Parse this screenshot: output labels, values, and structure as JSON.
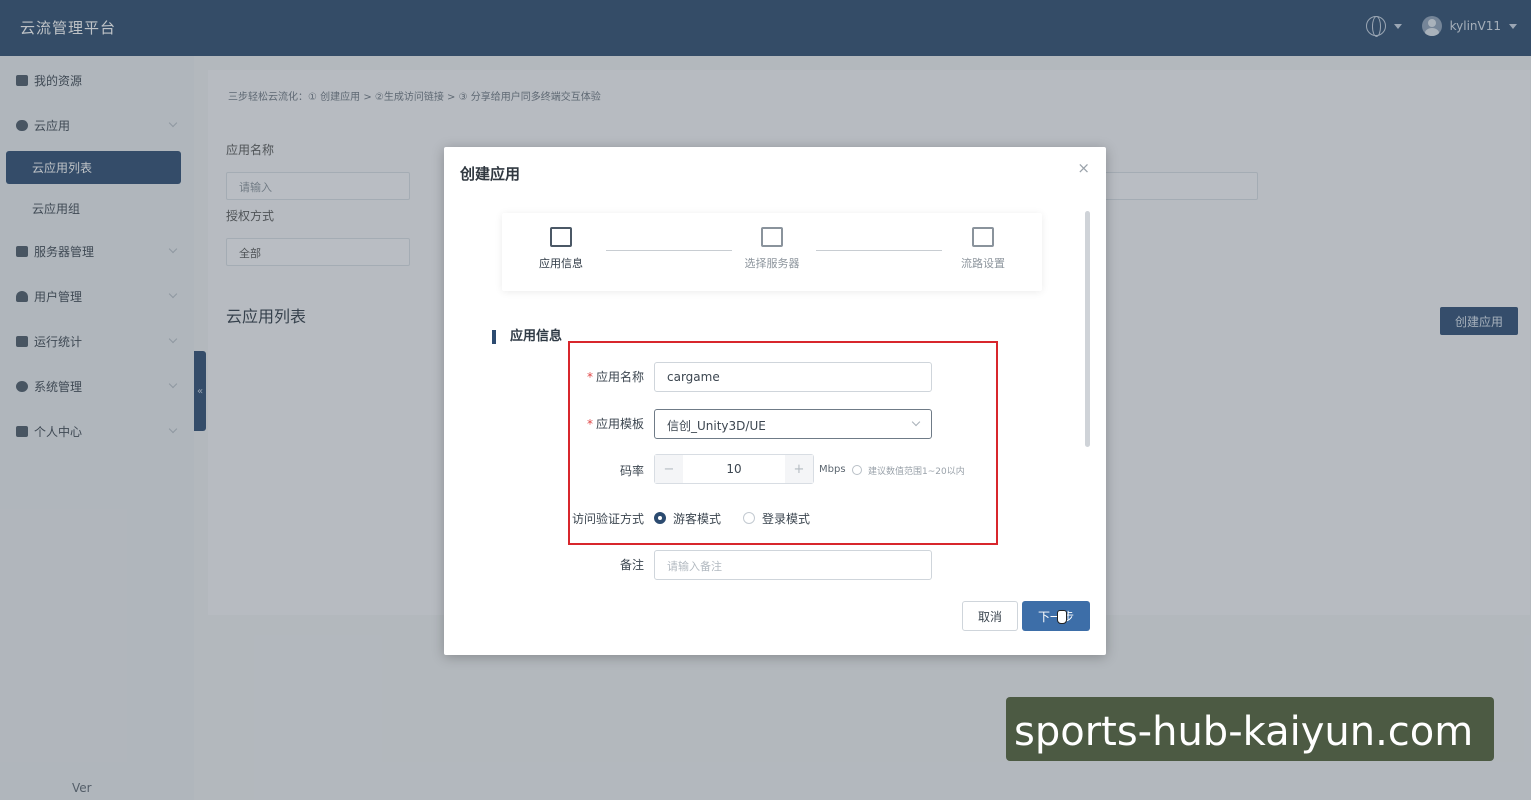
{
  "header": {
    "title": "云流管理平台",
    "username": "kylinV11"
  },
  "sidebar": {
    "items": [
      {
        "label": "我的资源"
      },
      {
        "label": "云应用"
      },
      {
        "label": "服务器管理"
      },
      {
        "label": "用户管理"
      },
      {
        "label": "运行统计"
      },
      {
        "label": "系统管理"
      },
      {
        "label": "个人中心"
      }
    ],
    "subitems": [
      {
        "label": "云应用列表",
        "active": true
      },
      {
        "label": "云应用组",
        "active": false
      }
    ],
    "version": "Ver"
  },
  "page": {
    "tip": "三步轻松云流化：① 创建应用 > ②生成访问链接 > ③ 分享给用户同多终端交互体验",
    "filters": {
      "app_name_label": "应用名称",
      "app_name_placeholder": "请输入",
      "auth_label": "授权方式",
      "auth_value": "全部"
    },
    "section_title": "云应用列表",
    "create_button": "创建应用"
  },
  "modal": {
    "title": "创建应用",
    "steps": [
      {
        "label": "应用信息",
        "active": true
      },
      {
        "label": "选择服务器",
        "active": false
      },
      {
        "label": "流路设置",
        "active": false
      }
    ],
    "section": "应用信息",
    "fields": {
      "name_label": "应用名称",
      "name_value": "cargame",
      "template_label": "应用模板",
      "template_value": "信创_Unity3D/UE",
      "bitrate_label": "码率",
      "bitrate_value": "10",
      "bitrate_unit": "Mbps",
      "bitrate_hint": "建议数值范围1~20以内",
      "auth_label": "访问验证方式",
      "auth_options": [
        "游客模式",
        "登录模式"
      ],
      "remark_label": "备注",
      "remark_placeholder": "请输入备注"
    },
    "buttons": {
      "cancel": "取消",
      "next": "下一步"
    }
  },
  "watermark": {
    "text": "sports-hub-kaiyun.com"
  },
  "colors": {
    "header_bg": "#2b4a6d",
    "accent": "#2c4b70",
    "primary_button": "#3d6ea8",
    "highlight_box": "#d8262c"
  }
}
